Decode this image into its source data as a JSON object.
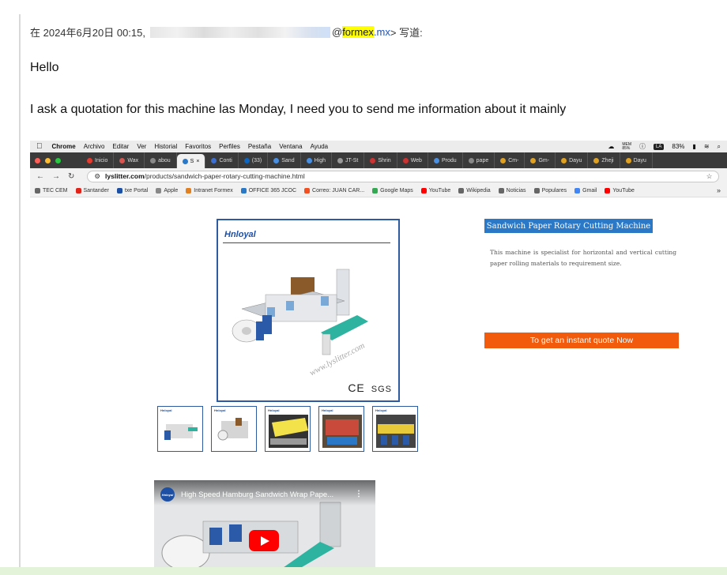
{
  "email": {
    "header_prefix": "在 2024年6月20日 00:15,",
    "sender_domain_highlight": "formex",
    "sender_suffix": ".mx",
    "header_suffix": "> 写道:",
    "greeting": "Hello",
    "body": "I ask a quotation for this machine las Monday,  I  need you to send me information about it mainly"
  },
  "screenshot": {
    "menubar": {
      "app": "Chrome",
      "items": [
        "Archivo",
        "Editar",
        "Ver",
        "Historial",
        "Favoritos",
        "Perfiles",
        "Pestaña",
        "Ventana",
        "Ayuda"
      ],
      "status": {
        "mem_label": "MEM",
        "mem_value": "85%",
        "battery": "83%",
        "lang": "LA"
      }
    },
    "tabs": [
      {
        "label": "Inicio",
        "color": "#e63b2e"
      },
      {
        "label": "Wax",
        "color": "#d9534f"
      },
      {
        "label": "abou",
        "color": "#888888"
      },
      {
        "label": "S",
        "color": "#2a78c6"
      },
      {
        "label": "Conti",
        "color": "#3b6fd4"
      },
      {
        "label": "(33)",
        "color": "#0a66c2"
      },
      {
        "label": "Sand",
        "color": "#4a90e2"
      },
      {
        "label": "High",
        "color": "#4a90e2"
      },
      {
        "label": "JT-St",
        "color": "#999999"
      },
      {
        "label": "Shrin",
        "color": "#cc3333"
      },
      {
        "label": "Web",
        "color": "#cc3333"
      },
      {
        "label": "Produ",
        "color": "#4a90e2"
      },
      {
        "label": "pape",
        "color": "#888888"
      },
      {
        "label": "Cm-",
        "color": "#e0a020"
      },
      {
        "label": "Gm-",
        "color": "#e0a020"
      },
      {
        "label": "Dayu",
        "color": "#e0a020"
      },
      {
        "label": "Zheji",
        "color": "#e0a020"
      },
      {
        "label": "Dayu",
        "color": "#e0a020"
      }
    ],
    "url_domain": "lyslitter.com",
    "url_path": "/products/sandwich-paper-rotary-cutting-machine.html",
    "bookmarks": [
      {
        "label": "TEC CEM",
        "color": "#666666"
      },
      {
        "label": "Santander",
        "color": "#e2231a"
      },
      {
        "label": "txe Portal",
        "color": "#1d4fa5"
      },
      {
        "label": "Apple",
        "color": "#888888"
      },
      {
        "label": "Intranet Formex",
        "color": "#e08020"
      },
      {
        "label": "OFFICE 365 JCOC",
        "color": "#2a78c6"
      },
      {
        "label": "Correo: JUAN CAR...",
        "color": "#f25022"
      },
      {
        "label": "Google Maps",
        "color": "#34a853"
      },
      {
        "label": "YouTube",
        "color": "#ff0000"
      },
      {
        "label": "Wikipedia",
        "color": "#666666"
      },
      {
        "label": "Noticias",
        "color": "#666666"
      },
      {
        "label": "Populares",
        "color": "#666666"
      },
      {
        "label": "Gmail",
        "color": "#4285f4"
      },
      {
        "label": "YouTube",
        "color": "#ff0000"
      }
    ],
    "product": {
      "brand": "Hnloyal",
      "watermark": "www.lyslitter.com",
      "cert_ce": "CE",
      "cert_sgs": "SGS",
      "thumb_brand": "Hnloyal",
      "title": "Sandwich Paper Rotary Cutting Machine",
      "description": "This machine is specialist for horizontal and vertical cutting paper rolling materials to requirement size.",
      "cta": "To get an instant quote Now"
    },
    "video": {
      "channel_logo": "Hnloyal",
      "title": "High Speed Hamburg Sandwich Wrap Pape..."
    }
  },
  "colors": {
    "highlight": "#ffff00",
    "link": "#1a55c7",
    "title_badge": "#2a78c6",
    "cta": "#f25a0c",
    "youtube_red": "#ff0000"
  }
}
